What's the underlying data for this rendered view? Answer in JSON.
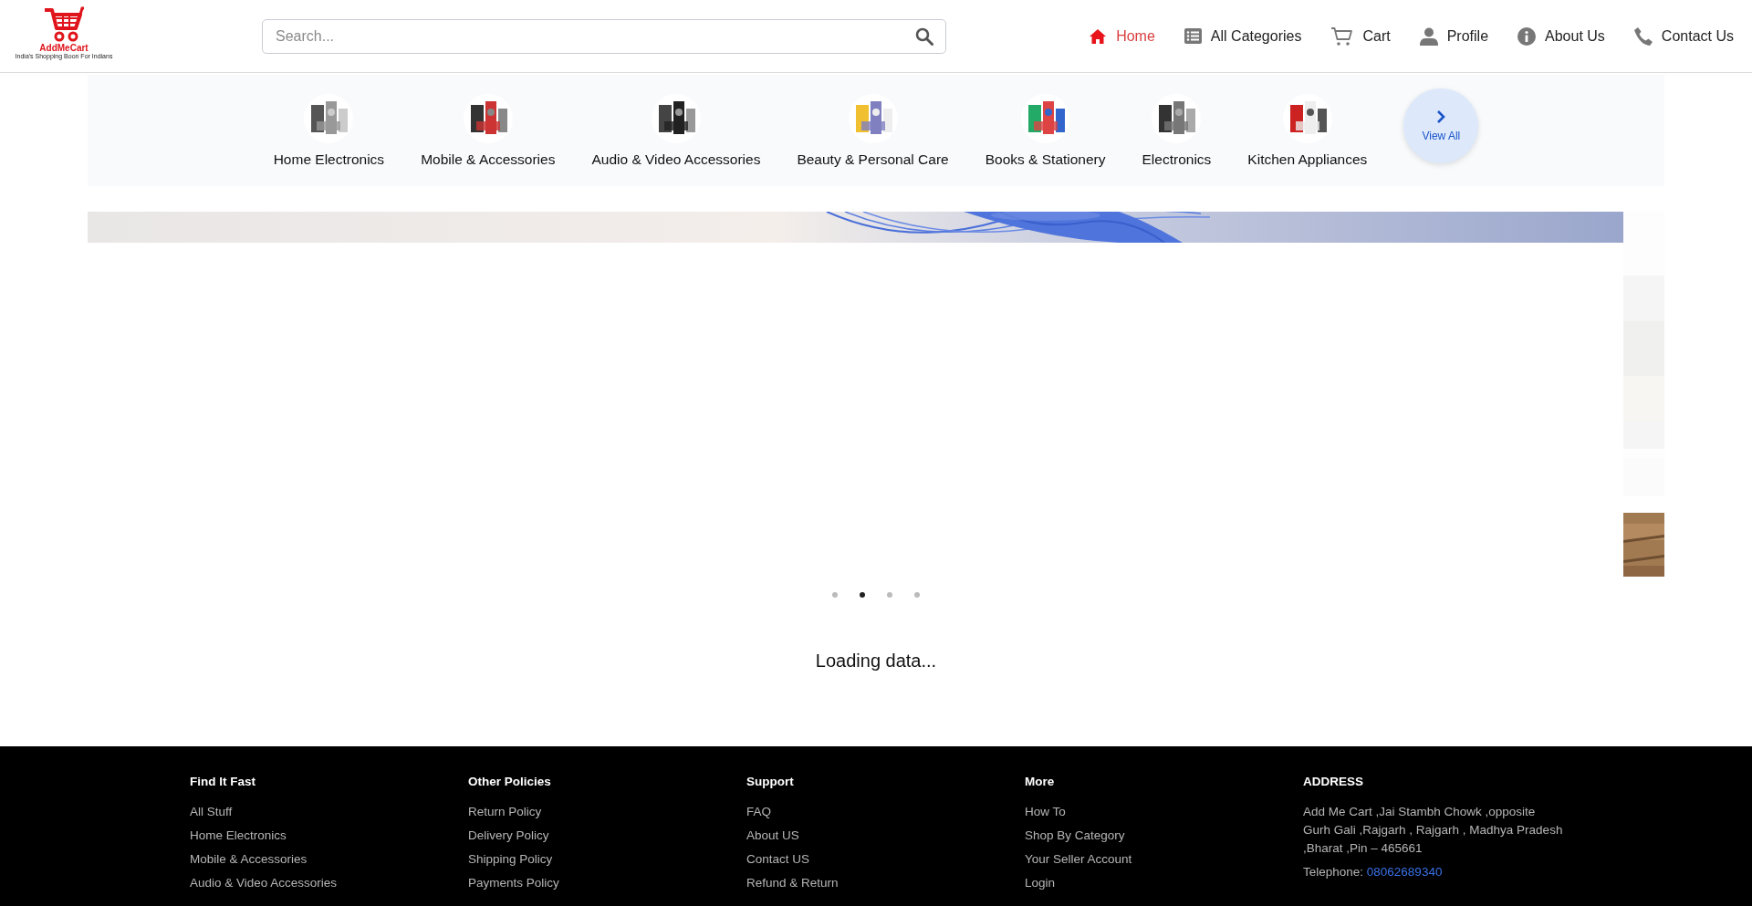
{
  "logo": {
    "name": "AddMeCart",
    "tagline": "India's Shopping Boon For Indians"
  },
  "search": {
    "placeholder": "Search..."
  },
  "nav": [
    {
      "label": "Home",
      "kind": "home",
      "selected": true
    },
    {
      "label": "All Categories",
      "kind": "list",
      "selected": false
    },
    {
      "label": "Cart",
      "kind": "cart",
      "selected": false
    },
    {
      "label": "Profile",
      "kind": "user",
      "selected": false
    },
    {
      "label": "About Us",
      "kind": "info",
      "selected": false
    },
    {
      "label": "Contact Us",
      "kind": "phone",
      "selected": false
    }
  ],
  "categories": [
    {
      "label": "Home Electronics"
    },
    {
      "label": "Mobile & Accessories"
    },
    {
      "label": "Audio & Video Accessories"
    },
    {
      "label": "Beauty & Personal Care"
    },
    {
      "label": "Books & Stationery"
    },
    {
      "label": "Electronics"
    },
    {
      "label": "Kitchen Appliances"
    }
  ],
  "view_all": {
    "label": "View All"
  },
  "carousel": {
    "dots": [
      {
        "selected": false
      },
      {
        "selected": true
      },
      {
        "selected": false
      },
      {
        "selected": false
      }
    ]
  },
  "status": "Loading data...",
  "footer": {
    "columns": [
      {
        "title": "Find It Fast",
        "links": [
          "All Stuff",
          "Home Electronics",
          "Mobile & Accessories",
          "Audio & Video Accessories"
        ]
      },
      {
        "title": "Other Policies",
        "links": [
          "Return Policy",
          "Delivery Policy",
          "Shipping Policy",
          "Payments Policy"
        ]
      },
      {
        "title": "Support",
        "links": [
          "FAQ",
          "About US",
          "Contact US",
          "Refund & Return"
        ]
      },
      {
        "title": "More",
        "links": [
          "How To",
          "Shop By Category",
          "Your Seller Account",
          "Login"
        ]
      }
    ],
    "address": {
      "title": "ADDRESS",
      "text": "Add Me Cart ,Jai Stambh Chowk ,opposite Gurh Gali ,Rajgarh , Rajgarh , Madhya Pradesh ,Bharat ,Pin – 465661",
      "telephone_label": "Telephone:",
      "telephone": "08062689340"
    }
  }
}
